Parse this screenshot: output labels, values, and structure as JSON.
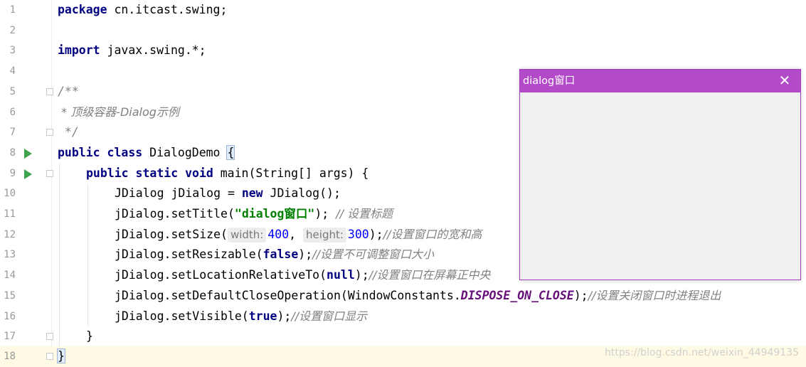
{
  "editor": {
    "line_numbers": [
      "1",
      "2",
      "3",
      "4",
      "5",
      "6",
      "7",
      "8",
      "9",
      "10",
      "11",
      "12",
      "13",
      "14",
      "15",
      "16",
      "17",
      "18"
    ],
    "lines": {
      "l1": {
        "kw": "package",
        "rest": " cn.itcast.swing;"
      },
      "l3": {
        "kw": "import",
        "rest": " javax.swing.*;"
      },
      "l5": {
        "text": "/**"
      },
      "l6": {
        "text": " * 顶级容器-Dialog示例"
      },
      "l7": {
        "text": " */"
      },
      "l8": {
        "kw": "public class",
        "rest": " DialogDemo ",
        "brace": "{"
      },
      "l9": {
        "kw": "public static void",
        "rest": " main(String[] args) {"
      },
      "l10": {
        "pre": "JDialog jDialog = ",
        "kw": "new",
        "rest": " JDialog();"
      },
      "l11": {
        "pre": "jDialog.setTitle(",
        "str": "\"dialog窗口\"",
        "rest": "); ",
        "comment": "// 设置标题"
      },
      "l12": {
        "pre": "jDialog.setSize(",
        "hint1": "width:",
        "num1": "400",
        "sep": ", ",
        "hint2": "height:",
        "num2": "300",
        "rest": ");",
        "comment": "//设置窗口的宽和高"
      },
      "l13": {
        "pre": "jDialog.setResizable(",
        "kw": "false",
        "rest": ");",
        "comment": "//设置不可调整窗口大小"
      },
      "l14": {
        "pre": "jDialog.setLocationRelativeTo(",
        "kw": "null",
        "rest": ");",
        "comment": "//设置窗口在屏幕正中央"
      },
      "l15": {
        "pre": "jDialog.setDefaultCloseOperation(WindowConstants.",
        "const": "DISPOSE_ON_CLOSE",
        "rest": ");",
        "comment": "//设置关闭窗口时进程退出"
      },
      "l16": {
        "pre": "jDialog.setVisible(",
        "kw": "true",
        "rest": ");",
        "comment": "//设置窗口显示"
      },
      "l17": {
        "text": "}"
      },
      "l18": {
        "text": "}"
      }
    }
  },
  "dialog": {
    "title": "dialog窗口",
    "close_glyph": "✕"
  },
  "watermark": "https://blog.csdn.net/weixin_44949135",
  "colors": {
    "dialog_title_bar": "#b34ac9",
    "keyword": "#000080",
    "string": "#008000",
    "number": "#0000ff",
    "comment": "#808080",
    "constant": "#660e7a",
    "run_icon": "#3fa34d"
  }
}
